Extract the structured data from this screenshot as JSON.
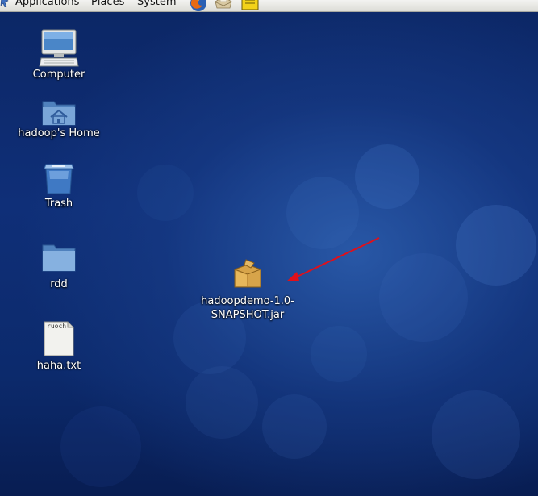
{
  "top_panel": {
    "menus": [
      {
        "label": "Applications"
      },
      {
        "label": "Places"
      },
      {
        "label": "System"
      }
    ],
    "launchers": [
      "firefox-icon",
      "mail-client-icon",
      "notes-icon"
    ]
  },
  "desktop": {
    "icons": [
      {
        "label": "Computer",
        "icon": "computer-icon"
      },
      {
        "label": "hadoop's Home",
        "icon": "home-folder-icon"
      },
      {
        "label": "Trash",
        "icon": "trash-icon"
      },
      {
        "label": "rdd",
        "icon": "folder-icon"
      },
      {
        "label": "haha.txt",
        "icon": "text-file-icon",
        "preview_text": "ruoch"
      },
      {
        "label_line1": "hadoopdemo-1.0-",
        "label_line2": "SNAPSHOT.jar",
        "icon": "jar-package-icon"
      }
    ],
    "annotation": {
      "type": "arrow",
      "color": "#e0101a",
      "points_to": "hadoopdemo-1.0-SNAPSHOT.jar"
    }
  }
}
